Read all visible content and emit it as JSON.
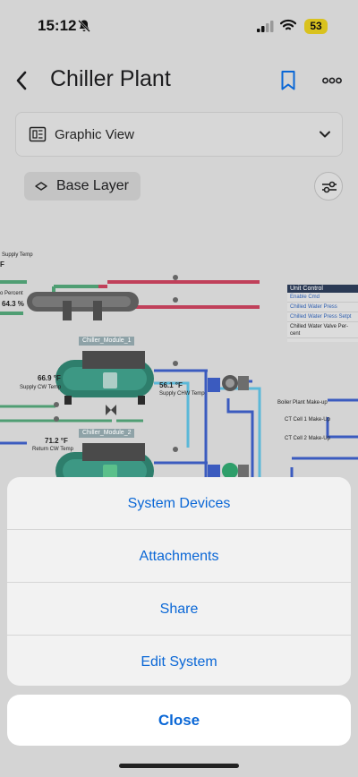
{
  "status": {
    "time": "15:12",
    "battery": "53"
  },
  "nav": {
    "title": "Chiller Plant"
  },
  "view_select": {
    "label": "Graphic View"
  },
  "layer": {
    "label": "Base Layer"
  },
  "diagram": {
    "supply_temp_label": "Supply Temp",
    "supply_temp_unit": "F",
    "percent_label": "o Percent",
    "percent_value": "64.3 %",
    "module1": "Chiller_Module_1",
    "module2": "Chiller_Module_2",
    "supply_cw_value": "66.9 °F",
    "supply_cw_label": "Supply CW Temp",
    "return_cw_value": "71.2 °F",
    "return_cw_label": "Return CW Temp",
    "supply_chw_value": "56.1 °F",
    "supply_chw_label": "Supply CHW Temp",
    "unit_control": {
      "title": "Unit Control",
      "rows": [
        "Enable Cmd",
        "Chilled Water Press",
        "Chilled Water Press Setpt"
      ],
      "valve": "Chilled Water Valve Per- cent"
    },
    "boiler_makeup": "Boiler Plant Make-up",
    "ct1_makeup": "CT Cell 1 Make-Up",
    "ct2_makeup": "CT Cell 2 Make-Up"
  },
  "sheet": {
    "items": [
      "System Devices",
      "Attachments",
      "Share",
      "Edit System"
    ],
    "close": "Close"
  },
  "colors": {
    "accent": "#0a67d6",
    "pipe_green": "#4f9e73",
    "pipe_red": "#c0405a",
    "pipe_blue": "#3b5bbf",
    "pipe_cyan": "#5bb8d8"
  }
}
